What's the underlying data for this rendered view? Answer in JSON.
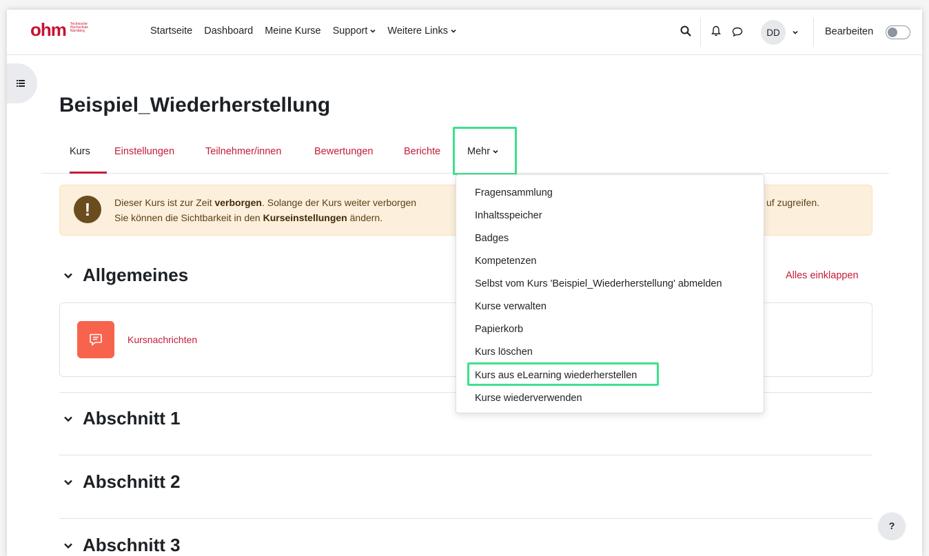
{
  "brand": {
    "logo_text": "ohm",
    "logo_sub": [
      "Technische",
      "Hochschule",
      "Nürnberg"
    ],
    "color": "#c8102e"
  },
  "navbar": {
    "links": [
      "Startseite",
      "Dashboard",
      "Meine Kurse",
      "Support",
      "Weitere Links"
    ],
    "avatar_initials": "DD",
    "edit_label": "Bearbeiten"
  },
  "course": {
    "title": "Beispiel_Wiederherstellung"
  },
  "tabs": [
    "Kurs",
    "Einstellungen",
    "Teilnehmer/innen",
    "Bewertungen",
    "Berichte",
    "Mehr"
  ],
  "alert": {
    "line1_pre": "Dieser Kurs ist zur Zeit ",
    "line1_bold": "verborgen",
    "line1_post": ". Solange der Kurs weiter verborgen",
    "line1_tail": "uf zugreifen.",
    "line2_pre": "Sie können die Sichtbarkeit in den ",
    "line2_bold": "Kurseinstellungen",
    "line2_post": " ändern."
  },
  "sections": {
    "general": "Allgemeines",
    "collapse_all": "Alles einklappen",
    "activity": "Kursnachrichten",
    "s1": "Abschnitt 1",
    "s2": "Abschnitt 2",
    "s3": "Abschnitt 3"
  },
  "more_menu": [
    "Fragensammlung",
    "Inhaltsspeicher",
    "Badges",
    "Kompetenzen",
    "Selbst vom Kurs 'Beispiel_Wiederherstellung' abmelden",
    "Kurse verwalten",
    "Papierkorb",
    "Kurs löschen",
    "Kurs aus eLearning wiederherstellen",
    "Kurse wiederverwenden"
  ],
  "help": "?",
  "colors": {
    "accent": "#c31c3a",
    "highlight": "#3ee08c",
    "alert_bg": "#fcefdc",
    "activity_icon": "#f7634d"
  }
}
